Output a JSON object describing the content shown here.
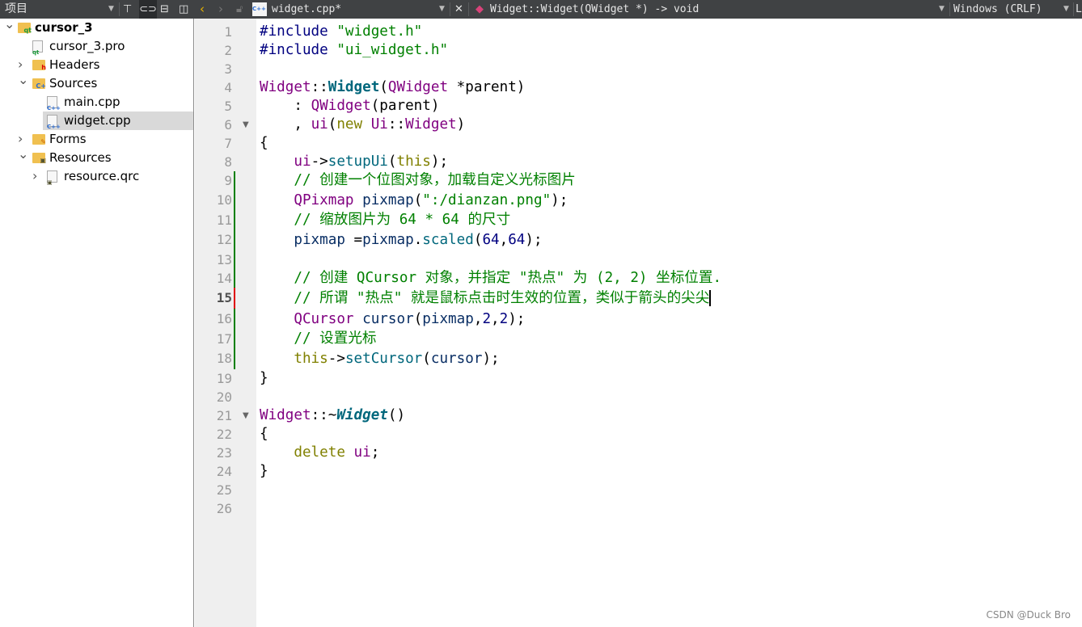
{
  "project_panel": {
    "title": "项目",
    "icons": [
      "filter-icon",
      "link-icon",
      "split-icon",
      "close-panel-icon"
    ]
  },
  "editor_bar": {
    "file_name": "widget.cpp*",
    "symbol": "Widget::Widget(QWidget *) -> void",
    "line_ending": "Windows (CRLF)",
    "trailing": "L"
  },
  "tree": [
    {
      "label": "cursor_3",
      "level": 0,
      "expanded": true,
      "bold": true,
      "icon": "qt-project-folder-icon"
    },
    {
      "label": "cursor_3.pro",
      "level": 1,
      "icon": "pro-file-icon"
    },
    {
      "label": "Headers",
      "level": 1,
      "expanded": false,
      "icon": "headers-folder-icon"
    },
    {
      "label": "Sources",
      "level": 1,
      "expanded": true,
      "icon": "sources-folder-icon"
    },
    {
      "label": "main.cpp",
      "level": 2,
      "icon": "cpp-file-icon"
    },
    {
      "label": "widget.cpp",
      "level": 2,
      "icon": "cpp-file-icon",
      "selected": true
    },
    {
      "label": "Forms",
      "level": 1,
      "expanded": false,
      "icon": "forms-folder-icon"
    },
    {
      "label": "Resources",
      "level": 1,
      "expanded": true,
      "icon": "resources-folder-icon"
    },
    {
      "label": "resource.qrc",
      "level": 2,
      "expanded": false,
      "icon": "qrc-file-icon"
    }
  ],
  "code": {
    "current_line": 15,
    "fold_lines": [
      6,
      21
    ],
    "changed_lines": [
      9,
      10,
      11,
      12,
      13,
      14,
      15,
      16,
      17,
      18
    ],
    "lines": [
      [
        [
          "#include ",
          "p"
        ],
        [
          "\"widget.h\"",
          "s"
        ]
      ],
      [
        [
          "#include ",
          "p"
        ],
        [
          "\"ui_widget.h\"",
          "s"
        ]
      ],
      [],
      [
        [
          "Widget",
          "t"
        ],
        [
          "::",
          ""
        ],
        [
          "Widget",
          "f"
        ],
        [
          "(",
          ""
        ],
        [
          "QWidget",
          "t"
        ],
        [
          " *parent)",
          ""
        ]
      ],
      [
        [
          "    : ",
          ""
        ],
        [
          "QWidget",
          "t"
        ],
        [
          "(parent)",
          ""
        ]
      ],
      [
        [
          "    , ",
          ""
        ],
        [
          "ui",
          "m"
        ],
        [
          "(",
          ""
        ],
        [
          "new",
          "k"
        ],
        [
          " ",
          ""
        ],
        [
          "Ui",
          "t"
        ],
        [
          "::",
          ""
        ],
        [
          "Widget",
          "t"
        ],
        [
          ")",
          ""
        ]
      ],
      [
        [
          "{",
          ""
        ]
      ],
      [
        [
          "    ",
          ""
        ],
        [
          "ui",
          "m"
        ],
        [
          "->",
          ""
        ],
        [
          "setupUi",
          "fn"
        ],
        [
          "(",
          ""
        ],
        [
          "this",
          "k"
        ],
        [
          ");",
          ""
        ]
      ],
      [
        [
          "    // 创建一个位图对象，加载自定义光标图片",
          "c"
        ]
      ],
      [
        [
          "    ",
          ""
        ],
        [
          "QPixmap",
          "t"
        ],
        [
          " ",
          ""
        ],
        [
          "pixmap",
          "v"
        ],
        [
          "(",
          ""
        ],
        [
          "\":/dianzan.png\"",
          "s"
        ],
        [
          ");",
          ""
        ]
      ],
      [
        [
          "    // 缩放图片为 64 * 64 的尺寸",
          "c"
        ]
      ],
      [
        [
          "    ",
          ""
        ],
        [
          "pixmap",
          "v"
        ],
        [
          " =",
          ""
        ],
        [
          "pixmap",
          "v"
        ],
        [
          ".",
          ""
        ],
        [
          "scaled",
          "fn"
        ],
        [
          "(",
          ""
        ],
        [
          "64",
          "n"
        ],
        [
          ",",
          ""
        ],
        [
          "64",
          "n"
        ],
        [
          ");",
          ""
        ]
      ],
      [],
      [
        [
          "    // 创建 QCursor 对象，并指定 \"热点\" 为 (2, 2) 坐标位置.",
          "c"
        ]
      ],
      [
        [
          "    // 所谓 \"热点\" 就是鼠标点击时生效的位置，类似于箭头的尖尖",
          "c"
        ]
      ],
      [
        [
          "    ",
          ""
        ],
        [
          "QCursor",
          "t"
        ],
        [
          " ",
          ""
        ],
        [
          "cursor",
          "v"
        ],
        [
          "(",
          ""
        ],
        [
          "pixmap",
          "v"
        ],
        [
          ",",
          ""
        ],
        [
          "2",
          "n"
        ],
        [
          ",",
          ""
        ],
        [
          "2",
          "n"
        ],
        [
          ");",
          ""
        ]
      ],
      [
        [
          "    // 设置光标",
          "c"
        ]
      ],
      [
        [
          "    ",
          ""
        ],
        [
          "this",
          "k"
        ],
        [
          "->",
          ""
        ],
        [
          "setCursor",
          "fn"
        ],
        [
          "(",
          ""
        ],
        [
          "cursor",
          "v"
        ],
        [
          ");",
          ""
        ]
      ],
      [
        [
          "}",
          ""
        ]
      ],
      [],
      [
        [
          "Widget",
          "t"
        ],
        [
          "::~",
          ""
        ],
        [
          "Widget",
          "fi"
        ],
        [
          "()",
          ""
        ]
      ],
      [
        [
          "{",
          ""
        ]
      ],
      [
        [
          "    ",
          ""
        ],
        [
          "delete",
          "k"
        ],
        [
          " ",
          ""
        ],
        [
          "ui",
          "m"
        ],
        [
          ";",
          ""
        ]
      ],
      [
        [
          "}",
          ""
        ]
      ],
      [],
      []
    ]
  },
  "watermark": "CSDN @Duck Bro",
  "colors": {
    "toolbar": "#404244",
    "gutter": "#efefef",
    "added": "#008000",
    "modified": "#e00000"
  }
}
